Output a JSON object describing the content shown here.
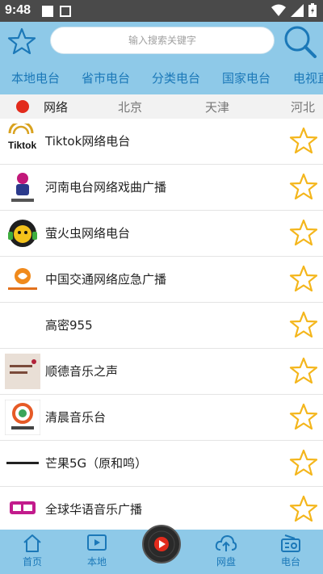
{
  "status_bar": {
    "time": "9:48"
  },
  "search": {
    "placeholder": "输入搜索关键字"
  },
  "category_tabs": [
    "本地电台",
    "省市电台",
    "分类电台",
    "国家电台",
    "电视直"
  ],
  "regions": [
    "网络",
    "北京",
    "天津",
    "河北"
  ],
  "stations": [
    {
      "name": "Tiktok网络电台",
      "icon": "tiktok-radio-logo",
      "logo_text": "Tiktok"
    },
    {
      "name": "河南电台网络戏曲广播",
      "icon": "henan-radio-logo",
      "logo_text": ""
    },
    {
      "name": "萤火虫网络电台",
      "icon": "firefly-radio-logo",
      "logo_text": ""
    },
    {
      "name": "中国交通网络应急广播",
      "icon": "china-traffic-radio-logo",
      "logo_text": ""
    },
    {
      "name": "高密955",
      "icon": "",
      "logo_text": ""
    },
    {
      "name": "顺德音乐之声",
      "icon": "shunde-music-logo",
      "logo_text": ""
    },
    {
      "name": "清晨音乐台",
      "icon": "morning-music-logo",
      "logo_text": ""
    },
    {
      "name": "芒果5G（原和鸣）",
      "icon": "mango-5g-logo",
      "logo_text": ""
    },
    {
      "name": "全球华语音乐广播",
      "icon": "global-chinese-music-logo",
      "logo_text": ""
    }
  ],
  "bottom_nav": [
    {
      "label": "首页",
      "icon": "home-icon"
    },
    {
      "label": "本地",
      "icon": "local-play-icon"
    },
    {
      "label": "网盘",
      "icon": "cloud-upload-icon"
    },
    {
      "label": "电台",
      "icon": "radio-icon"
    }
  ],
  "colors": {
    "header_bg": "#8ec9e8",
    "accent": "#1b78b8",
    "star": "#f4b61c",
    "record_red": "#e22b1c"
  }
}
